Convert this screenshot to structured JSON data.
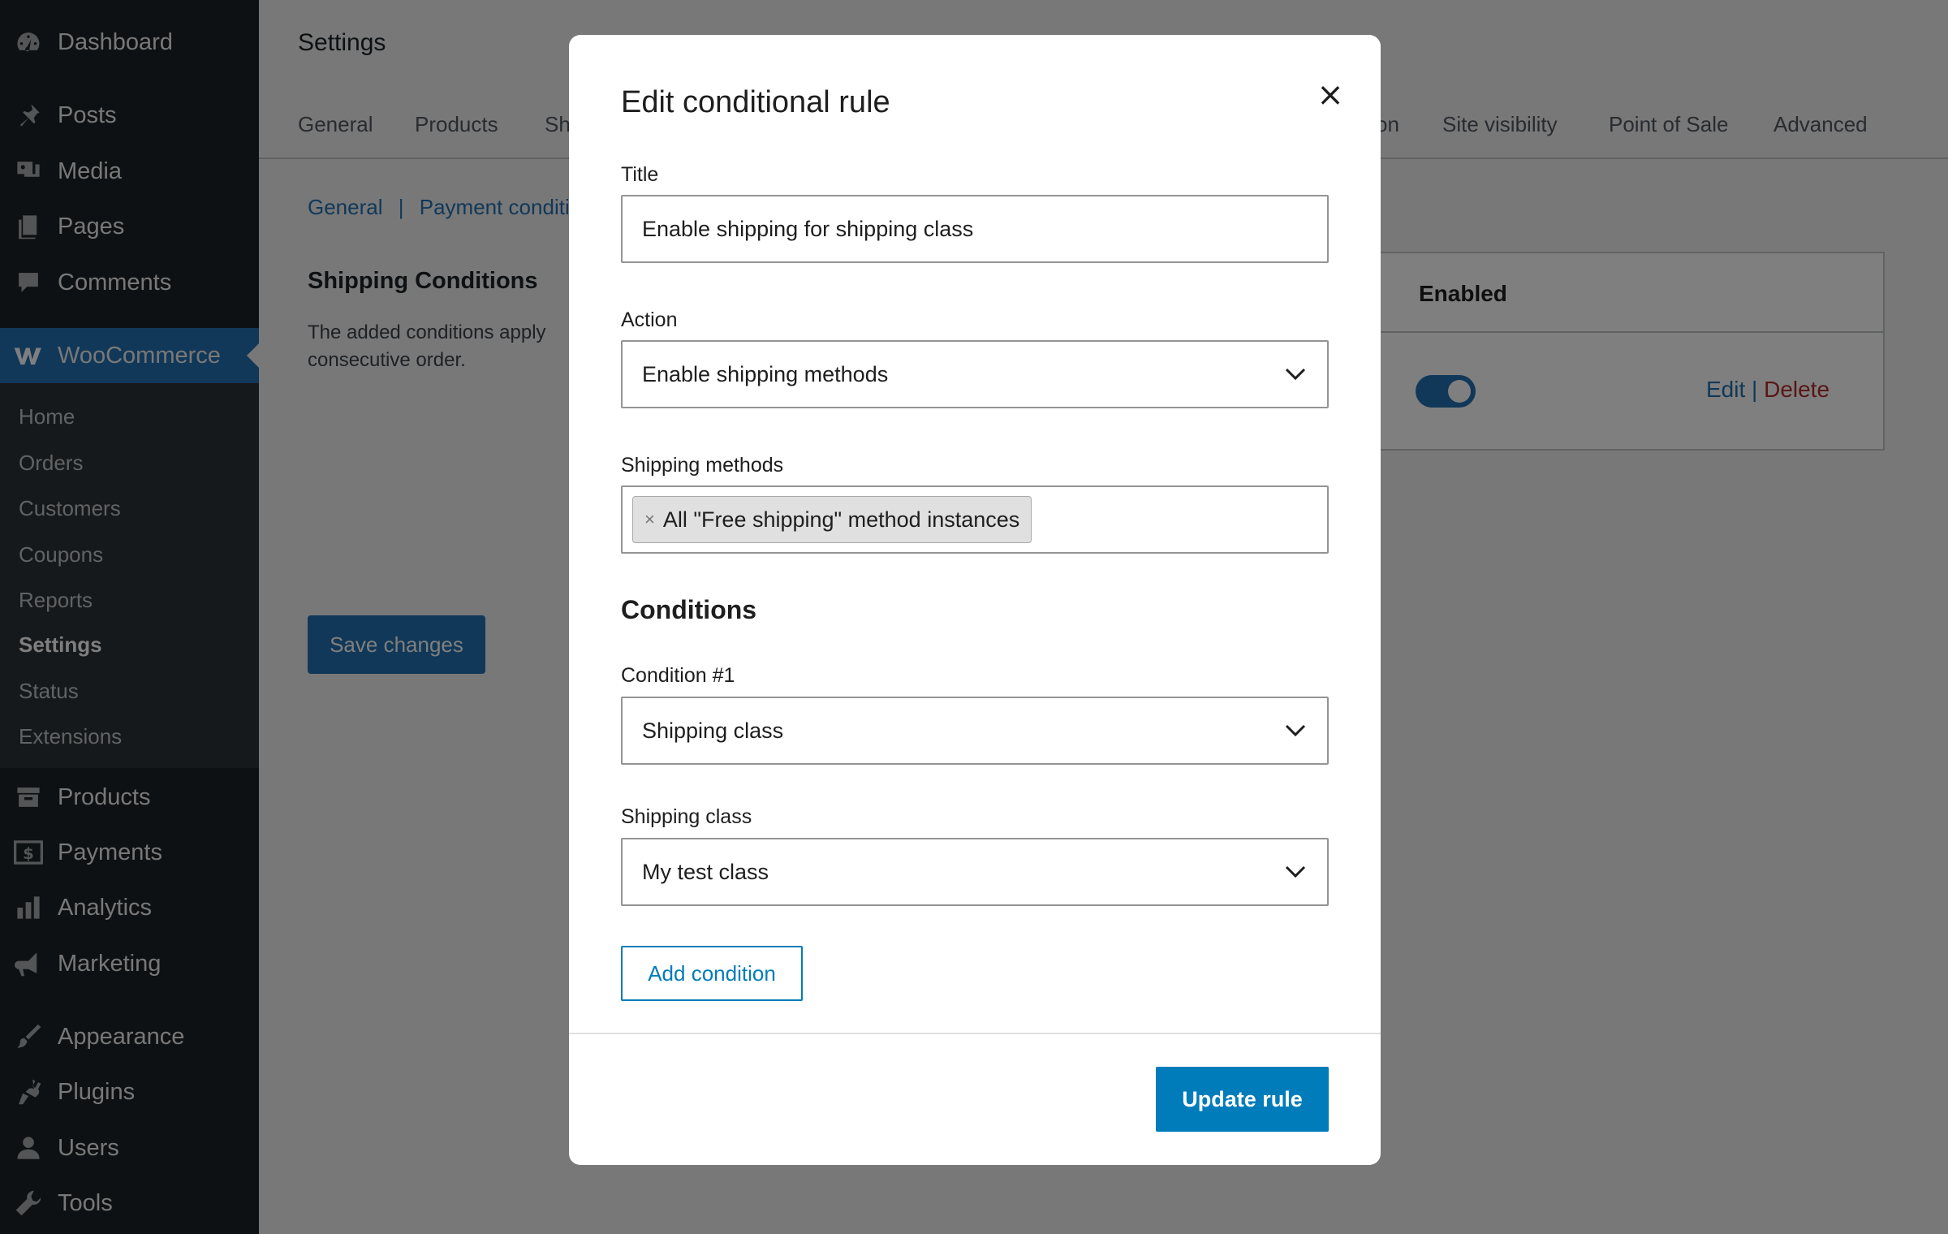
{
  "sidebar": {
    "items": [
      {
        "label": "Dashboard",
        "icon": "dashboard-icon"
      },
      {
        "label": "Posts",
        "icon": "pin-icon"
      },
      {
        "label": "Media",
        "icon": "media-icon"
      },
      {
        "label": "Pages",
        "icon": "pages-icon"
      },
      {
        "label": "Comments",
        "icon": "comment-icon"
      },
      {
        "label": "WooCommerce",
        "icon": "woo-icon"
      },
      {
        "label": "Products",
        "icon": "archive-icon"
      },
      {
        "label": "Payments",
        "icon": "dollar-icon"
      },
      {
        "label": "Analytics",
        "icon": "bar-chart-icon"
      },
      {
        "label": "Marketing",
        "icon": "megaphone-icon"
      },
      {
        "label": "Appearance",
        "icon": "brush-icon"
      },
      {
        "label": "Plugins",
        "icon": "plug-icon"
      },
      {
        "label": "Users",
        "icon": "user-icon"
      },
      {
        "label": "Tools",
        "icon": "wrench-icon"
      }
    ],
    "woo_submenu": [
      "Home",
      "Orders",
      "Customers",
      "Coupons",
      "Reports",
      "Settings",
      "Status",
      "Extensions"
    ]
  },
  "page": {
    "title": "Settings",
    "tabs": [
      "General",
      "Products",
      "Sh",
      "on",
      "Site visibility",
      "Point of Sale",
      "Advanced"
    ],
    "breadcrumb": {
      "first": "General",
      "sep": "|",
      "second": "Payment conditi"
    },
    "section_title": "Shipping Conditions",
    "section_desc": "The added conditions apply consecutive order.",
    "save_label": "Save changes",
    "table": {
      "enabled_header": "Enabled",
      "edit": "Edit",
      "sep": "|",
      "delete": "Delete",
      "enabled": true
    }
  },
  "modal": {
    "title": "Edit conditional rule",
    "close": "×",
    "title_label": "Title",
    "title_value": "Enable shipping for shipping class",
    "action_label": "Action",
    "action_value": "Enable shipping methods",
    "methods_label": "Shipping methods",
    "method_tag": "All \"Free shipping\" method instances",
    "tag_remove": "×",
    "conditions_title": "Conditions",
    "condition1_label": "Condition #1",
    "condition1_value": "Shipping class",
    "class_label": "Shipping class",
    "class_value": "My test class",
    "add_condition": "Add condition",
    "update_rule": "Update rule"
  },
  "colors": {
    "sidebar_bg": "#1d2327",
    "submenu_bg": "#2c3338",
    "wp_blue": "#2271b1",
    "primary_button": "#007cba",
    "delete_red": "#b32d2e"
  }
}
